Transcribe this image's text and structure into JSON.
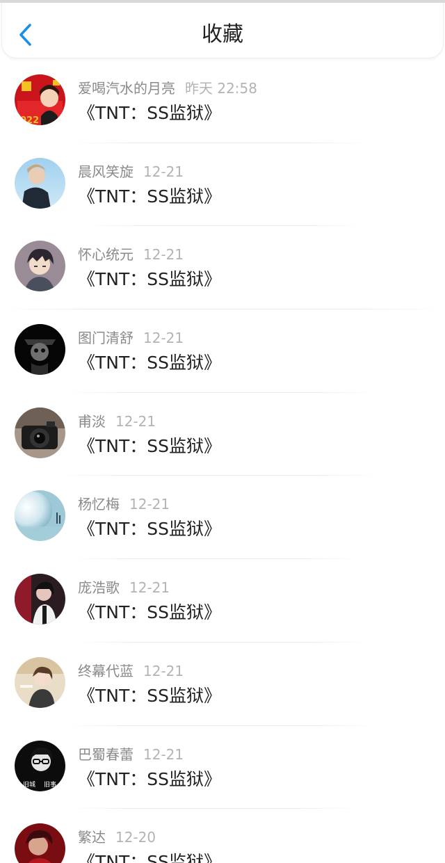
{
  "header": {
    "title": "收藏",
    "back_icon": "chevron-left-icon",
    "accent_color": "#1a8ee8"
  },
  "items": [
    {
      "author": "爱喝汽水的月亮",
      "time": "昨天 22:58",
      "title": "《TNT：SS监狱》",
      "avatar_icon": "avatar-red-festive"
    },
    {
      "author": "晨风笑旋",
      "time": "12-21",
      "title": "《TNT：SS监狱》",
      "avatar_icon": "avatar-boy-sky"
    },
    {
      "author": "怀心统元",
      "time": "12-21",
      "title": "《TNT：SS监狱》",
      "avatar_icon": "avatar-anime-boy"
    },
    {
      "author": "图门清舒",
      "time": "12-21",
      "title": "《TNT：SS监狱》",
      "avatar_icon": "avatar-dark-skull"
    },
    {
      "author": "甫淡",
      "time": "12-21",
      "title": "《TNT：SS监狱》",
      "avatar_icon": "avatar-camera"
    },
    {
      "author": "杨忆梅",
      "time": "12-21",
      "title": "《TNT：SS监狱》",
      "avatar_icon": "avatar-moon"
    },
    {
      "author": "庞浩歌",
      "time": "12-21",
      "title": "《TNT：SS监狱》",
      "avatar_icon": "avatar-red-dark"
    },
    {
      "author": "终幕代蓝",
      "time": "12-21",
      "title": "《TNT：SS监狱》",
      "avatar_icon": "avatar-girl-light"
    },
    {
      "author": "巴蜀春蕾",
      "time": "12-21",
      "title": "《TNT：SS监狱》",
      "avatar_icon": "avatar-glasses",
      "avatar_text": [
        "旧城",
        "旧事"
      ]
    },
    {
      "author": "繁达",
      "time": "12-20",
      "title": "《TNT：SS监狱》",
      "avatar_icon": "avatar-red-person"
    }
  ]
}
